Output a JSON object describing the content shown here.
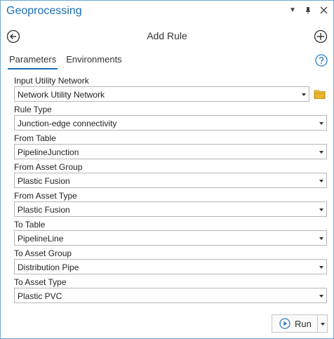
{
  "titlebar": {
    "title": "Geoprocessing",
    "controls": [
      "caret-down-icon",
      "pin-icon",
      "close-icon"
    ]
  },
  "header": {
    "tool_title": "Add Rule"
  },
  "tabs": [
    {
      "label": "Parameters",
      "active": true
    },
    {
      "label": "Environments",
      "active": false
    }
  ],
  "params": [
    {
      "label": "Input Utility Network",
      "value": "Network Utility Network",
      "has_browse": true
    },
    {
      "label": "Rule Type",
      "value": "Junction-edge connectivity"
    },
    {
      "label": "From Table",
      "value": "PipelineJunction"
    },
    {
      "label": "From Asset Group",
      "value": "Plastic Fusion"
    },
    {
      "label": "From Asset Type",
      "value": "Plastic Fusion"
    },
    {
      "label": "To Table",
      "value": "PipelineLine"
    },
    {
      "label": "To Asset Group",
      "value": "Distribution Pipe"
    },
    {
      "label": "To Asset Type",
      "value": "Plastic PVC"
    }
  ],
  "run": {
    "label": "Run"
  },
  "colors": {
    "accent": "#1b6eb5",
    "border": "#6fa6d6",
    "folder": "#e8b32e",
    "help": "#2f7dc8"
  }
}
